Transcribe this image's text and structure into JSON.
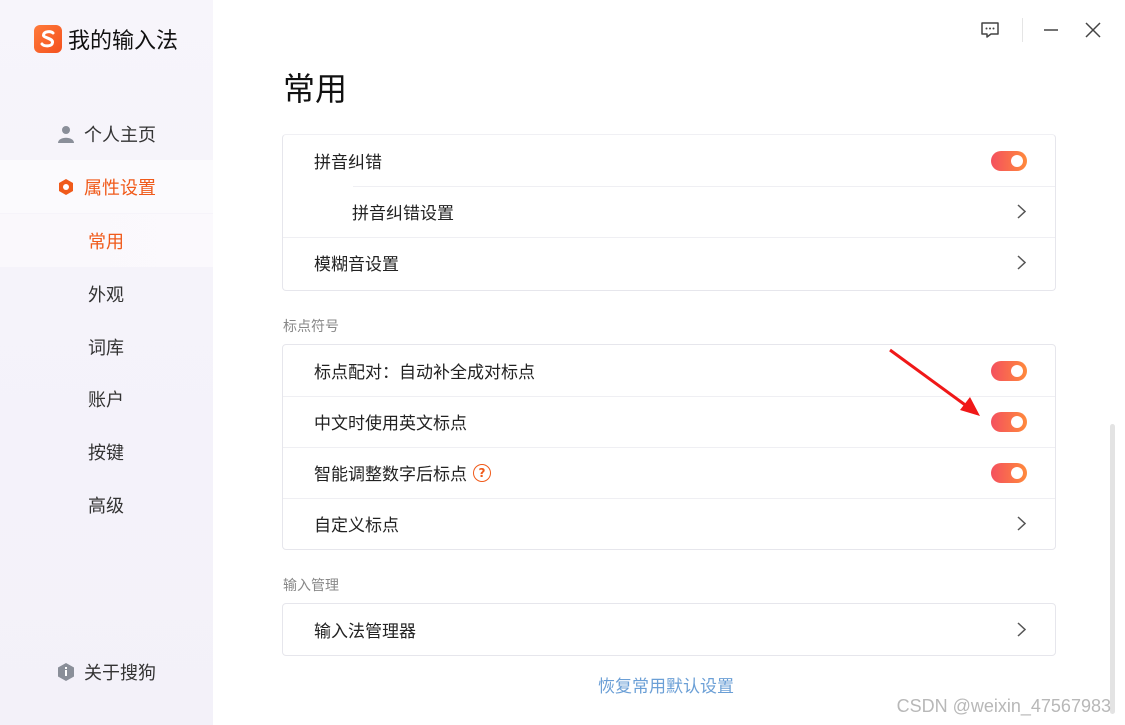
{
  "app": {
    "title": "我的输入法"
  },
  "sidebar": {
    "items": [
      {
        "label": "个人主页"
      },
      {
        "label": "属性设置"
      },
      {
        "label": "关于搜狗"
      }
    ],
    "subitems": [
      {
        "label": "常用"
      },
      {
        "label": "外观"
      },
      {
        "label": "词库"
      },
      {
        "label": "账户"
      },
      {
        "label": "按键"
      },
      {
        "label": "高级"
      }
    ]
  },
  "main": {
    "title": "常用",
    "group1": {
      "rows": [
        {
          "label": "拼音纠错"
        },
        {
          "label": "拼音纠错设置"
        },
        {
          "label": "模糊音设置"
        }
      ]
    },
    "section2": {
      "label": "标点符号",
      "rows": [
        {
          "label": "标点配对：自动补全成对标点"
        },
        {
          "label": "中文时使用英文标点"
        },
        {
          "label": "智能调整数字后标点",
          "help": "?"
        },
        {
          "label": "自定义标点"
        }
      ]
    },
    "section3": {
      "label": "输入管理",
      "rows": [
        {
          "label": "输入法管理器"
        }
      ]
    },
    "restore_label": "恢复常用默认设置"
  },
  "toggles": {
    "pinyin_correction": true,
    "punct_pairing": true,
    "english_punct": true,
    "smart_punct": true
  },
  "colors": {
    "accent": "#f05a1a",
    "link": "#6b9fd6"
  },
  "watermark": "CSDN @weixin_47567983"
}
